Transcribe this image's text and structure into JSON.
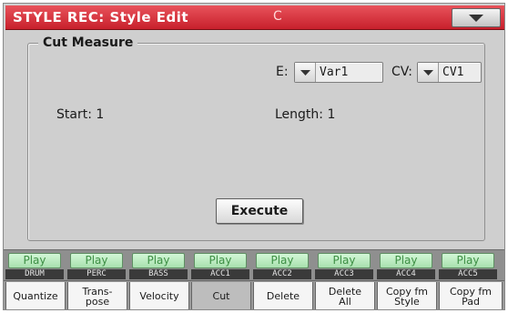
{
  "header": {
    "title": "STYLE REC: Style Edit",
    "subtitle": "C",
    "menu_icon": "chevron-down-icon"
  },
  "panel": {
    "title": "Cut Measure",
    "e_label": "E:",
    "e_value": "Var1",
    "cv_label": "CV:",
    "cv_value": "CV1",
    "start_label": "Start: 1",
    "length_label": "Length: 1",
    "execute_label": "Execute"
  },
  "tracks": [
    {
      "play": "Play",
      "name": "DRUM"
    },
    {
      "play": "Play",
      "name": "PERC"
    },
    {
      "play": "Play",
      "name": "BASS"
    },
    {
      "play": "Play",
      "name": "ACC1"
    },
    {
      "play": "Play",
      "name": "ACC2"
    },
    {
      "play": "Play",
      "name": "ACC3"
    },
    {
      "play": "Play",
      "name": "ACC4"
    },
    {
      "play": "Play",
      "name": "ACC5"
    }
  ],
  "tabs": [
    {
      "label": "Quantize",
      "active": false
    },
    {
      "label": "Trans-\npose",
      "active": false
    },
    {
      "label": "Velocity",
      "active": false
    },
    {
      "label": "Cut",
      "active": true
    },
    {
      "label": "Delete",
      "active": false
    },
    {
      "label": "Delete\nAll",
      "active": false
    },
    {
      "label": "Copy fm\nStyle",
      "active": false
    },
    {
      "label": "Copy fm\nPad",
      "active": false
    }
  ],
  "colors": {
    "title_bar": "#d3303a",
    "play_text": "#3e8f45",
    "play_bg": "#bfeec4"
  }
}
